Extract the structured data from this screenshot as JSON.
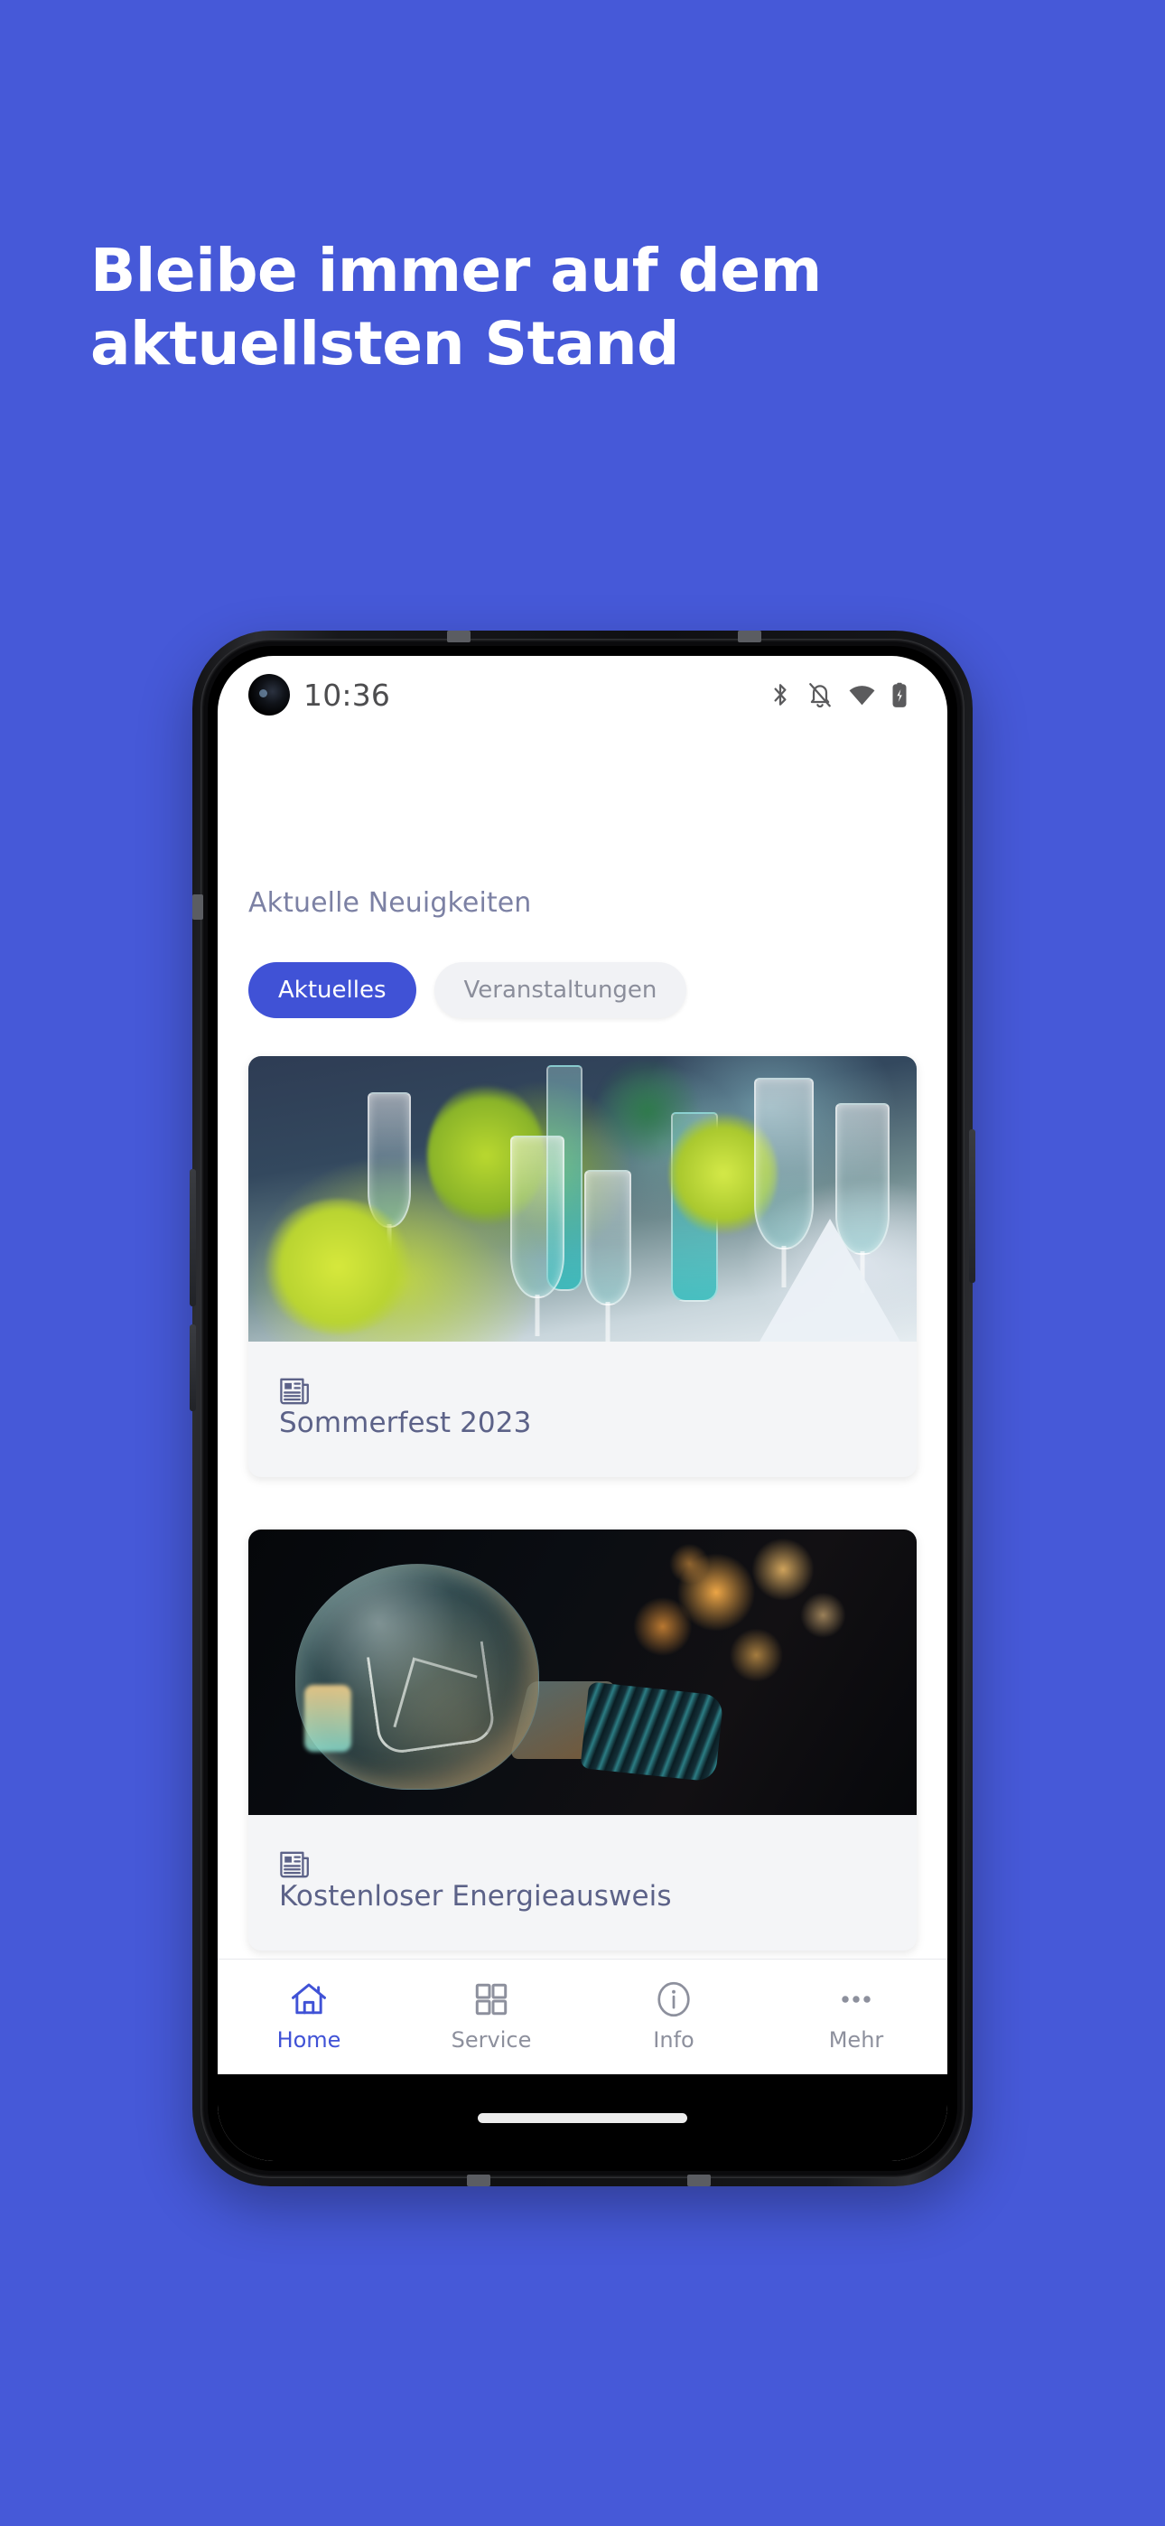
{
  "marketing": {
    "headline": "Bleibe immer auf dem aktuellsten Stand",
    "background_color": "#4659D8",
    "headline_color": "#FFFFFF"
  },
  "device": {
    "frame_color": "#121214",
    "screen_background": "#FFFFFF"
  },
  "status_bar": {
    "time": "10:36",
    "icons": [
      "bluetooth-icon",
      "notifications-off-icon",
      "wifi-icon",
      "battery-charging-icon"
    ],
    "icon_color": "#5b5b5d",
    "time_color": "#4d4d4f"
  },
  "app": {
    "section_title": "Aktuelle Neuigkeiten",
    "section_title_color": "#7c81a4",
    "accent_color": "#4052D6",
    "tabs": [
      {
        "label": "Aktuelles",
        "active": true
      },
      {
        "label": "Veranstaltungen",
        "active": false
      }
    ],
    "news_cards": [
      {
        "title": "Sommerfest 2023",
        "icon": "newspaper-icon",
        "image_alt": "Festlich gedeckter Tisch mit Sektgläsern und gelbgrünen Blumen"
      },
      {
        "title": "Kostenloser Energieausweis",
        "icon": "newspaper-icon",
        "image_alt": "Glühbirne vor orangefarbenen Bokeh-Lichtern"
      }
    ],
    "card_background": "#F4F5F7",
    "card_title_color": "#5c6288",
    "bottom_nav": [
      {
        "label": "Home",
        "icon": "home-icon",
        "active": true
      },
      {
        "label": "Service",
        "icon": "grid-icon",
        "active": false
      },
      {
        "label": "Info",
        "icon": "info-icon",
        "active": false
      },
      {
        "label": "Mehr",
        "icon": "ellipsis-icon",
        "active": false
      }
    ]
  }
}
